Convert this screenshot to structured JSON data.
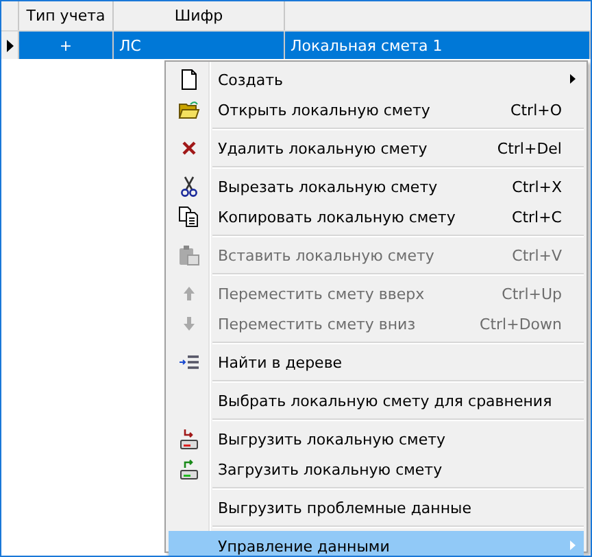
{
  "table": {
    "columns": [
      "Тип учета",
      "Шифр"
    ],
    "rows": [
      {
        "selected": true,
        "cells": [
          "+",
          "ЛС",
          "Локальная смета 1"
        ]
      }
    ]
  },
  "context_menu": {
    "items": [
      {
        "kind": "item",
        "label": "Создать",
        "submenu": true,
        "disabled": false,
        "selected": false
      },
      {
        "kind": "item",
        "label": "Открыть локальную смету",
        "shortcut": "Ctrl+O",
        "disabled": false,
        "selected": false
      },
      {
        "kind": "separator"
      },
      {
        "kind": "item",
        "label": "Удалить локальную смету",
        "shortcut": "Ctrl+Del",
        "disabled": false,
        "selected": false
      },
      {
        "kind": "separator"
      },
      {
        "kind": "item",
        "label": "Вырезать локальную смету",
        "shortcut": "Ctrl+X",
        "disabled": false,
        "selected": false
      },
      {
        "kind": "item",
        "label": "Копировать локальную смету",
        "shortcut": "Ctrl+C",
        "disabled": false,
        "selected": false
      },
      {
        "kind": "separator"
      },
      {
        "kind": "item",
        "label": "Вставить локальную смету",
        "shortcut": "Ctrl+V",
        "disabled": true,
        "selected": false
      },
      {
        "kind": "separator"
      },
      {
        "kind": "item",
        "label": "Переместить смету вверх",
        "shortcut": "Ctrl+Up",
        "disabled": true,
        "selected": false
      },
      {
        "kind": "item",
        "label": "Переместить смету вниз",
        "shortcut": "Ctrl+Down",
        "disabled": true,
        "selected": false
      },
      {
        "kind": "separator"
      },
      {
        "kind": "item",
        "label": "Найти в дереве",
        "disabled": false,
        "selected": false
      },
      {
        "kind": "separator"
      },
      {
        "kind": "item",
        "label": "Выбрать локальную смету для сравнения",
        "disabled": false,
        "selected": false
      },
      {
        "kind": "separator"
      },
      {
        "kind": "item",
        "label": "Выгрузить локальную смету",
        "disabled": false,
        "selected": false
      },
      {
        "kind": "item",
        "label": "Загрузить локальную смету",
        "disabled": false,
        "selected": false
      },
      {
        "kind": "separator"
      },
      {
        "kind": "item",
        "label": "Выгрузить проблемные данные",
        "disabled": false,
        "selected": false
      },
      {
        "kind": "separator"
      },
      {
        "kind": "item",
        "label": "Управление данными",
        "submenu": true,
        "disabled": false,
        "selected": true
      }
    ]
  }
}
